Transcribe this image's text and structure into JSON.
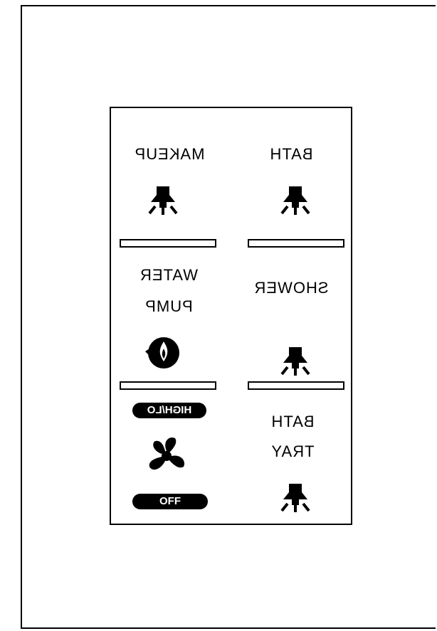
{
  "switches": {
    "makeup_label": "MAKEUP",
    "bath_label": "BATH",
    "water_label_1": "WATER",
    "water_label_2": "PUMP",
    "shower_label": "SHOWER",
    "fan_speed_label": "HIGH/LO",
    "fan_off_label": "OFF",
    "bath_tray_label_1": "BATH",
    "bath_tray_label_2": "TRAY"
  },
  "icons": {
    "light": "bell-light-icon",
    "water_pump": "water-pump-icon",
    "fan": "fan-icon"
  },
  "colors": {
    "ink": "#000000",
    "background": "#ffffff"
  }
}
